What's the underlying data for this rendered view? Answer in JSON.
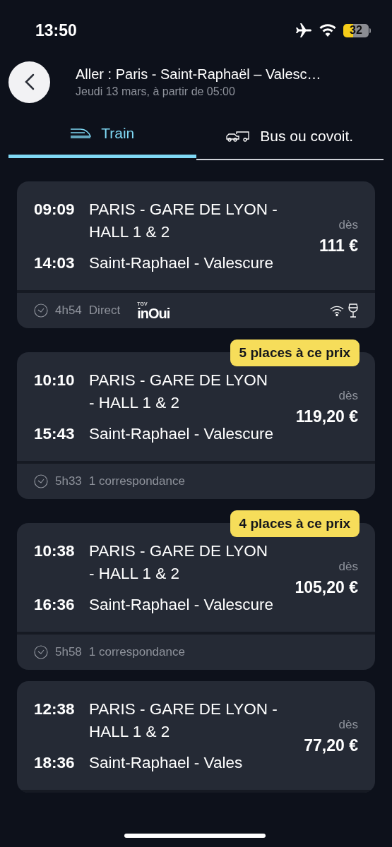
{
  "status_bar": {
    "time": "13:50",
    "battery": "32"
  },
  "header": {
    "title": "Aller : Paris - Saint-Raphaël – Valesc…",
    "subtitle": "Jeudi 13 mars, à partir de 05:00"
  },
  "tabs": [
    {
      "label": "Train",
      "kind": "train",
      "selected": true
    },
    {
      "label": "Bus ou covoit.",
      "kind": "bus",
      "selected": false
    }
  ],
  "journeys": [
    {
      "departure_time": "09:09",
      "departure_station": "PARIS - GARE DE LYON - HALL 1 & 2",
      "arrival_time": "14:03",
      "arrival_station": "Saint-Raphael - Valescure",
      "price_prefix": "dès",
      "price": "111 €",
      "duration": "4h54",
      "connection": "Direct",
      "brand": {
        "top": "TGV",
        "name": "inOui"
      },
      "amenities": [
        {
          "kind": "wifi"
        },
        {
          "kind": "bar"
        }
      ]
    },
    {
      "badge": "5 places à ce prix",
      "departure_time": "10:10",
      "departure_station": "PARIS - GARE DE LYON - HALL 1 & 2",
      "arrival_time": "15:43",
      "arrival_station": "Saint-Raphael - Valescure",
      "price_prefix": "dès",
      "price": "119,20 €",
      "duration": "5h33",
      "connection": "1 correspondance"
    },
    {
      "badge": "4 places à ce prix",
      "departure_time": "10:38",
      "departure_station": "PARIS - GARE DE LYON - HALL 1 & 2",
      "arrival_time": "16:36",
      "arrival_station": "Saint-Raphael - Valescure",
      "price_prefix": "dès",
      "price": "105,20 €",
      "duration": "5h58",
      "connection": "1 correspondance"
    },
    {
      "departure_time": "12:38",
      "departure_station": "PARIS - GARE DE LYON - HALL 1 & 2",
      "arrival_time": "18:36",
      "arrival_station": "Saint-Raphael - Vales",
      "price_prefix": "dès",
      "price": "77,20 €"
    }
  ]
}
